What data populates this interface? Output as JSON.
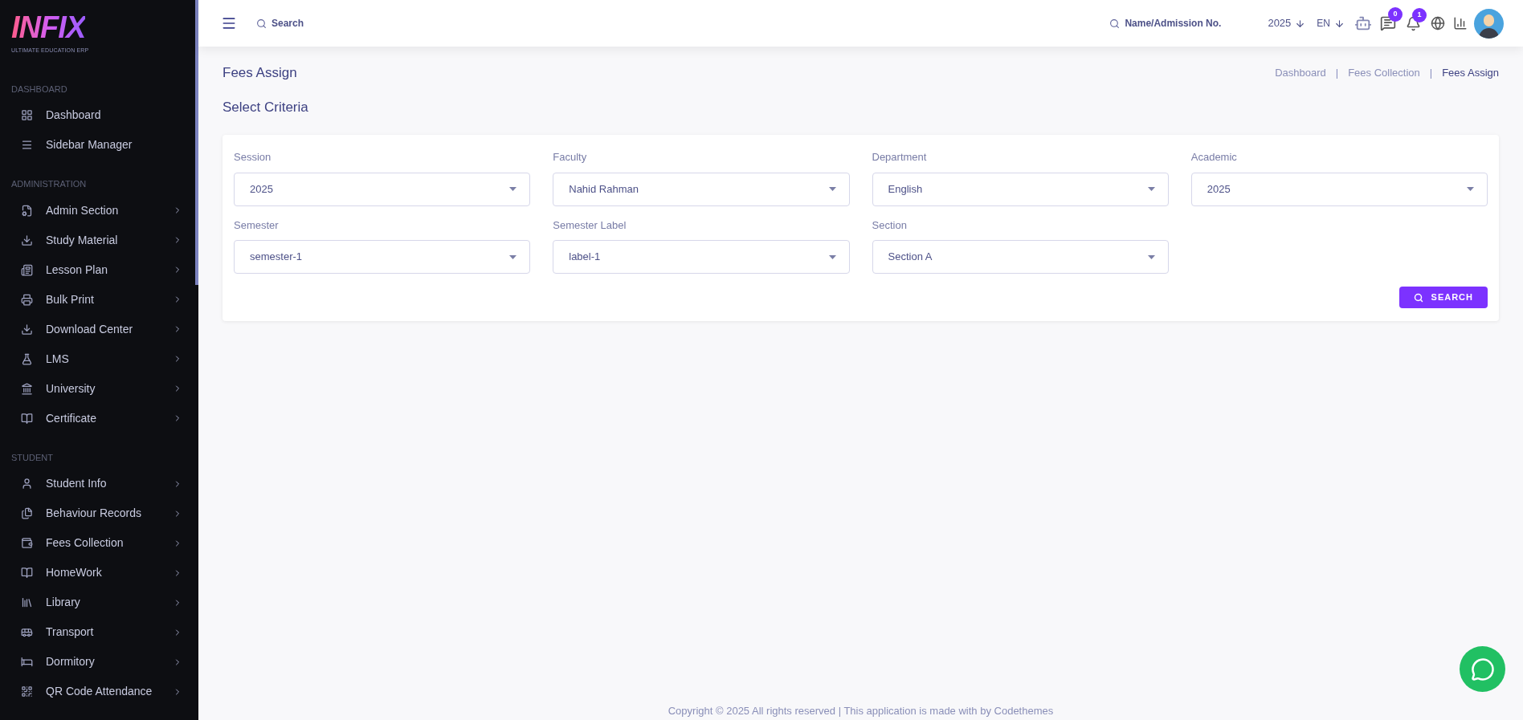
{
  "logo": {
    "text": "INFIX",
    "tagline": "ULTIMATE EDUCATION ERP"
  },
  "sidebar": {
    "sections": [
      {
        "heading": "DASHBOARD",
        "items": [
          {
            "label": "Dashboard",
            "expandable": false
          },
          {
            "label": "Sidebar Manager",
            "expandable": false
          }
        ]
      },
      {
        "heading": "ADMINISTRATION",
        "items": [
          {
            "label": "Admin Section",
            "expandable": true
          },
          {
            "label": "Study Material",
            "expandable": true
          },
          {
            "label": "Lesson Plan",
            "expandable": true
          },
          {
            "label": "Bulk Print",
            "expandable": true
          },
          {
            "label": "Download Center",
            "expandable": true
          },
          {
            "label": "LMS",
            "expandable": true
          },
          {
            "label": "University",
            "expandable": true
          },
          {
            "label": "Certificate",
            "expandable": true
          }
        ]
      },
      {
        "heading": "STUDENT",
        "items": [
          {
            "label": "Student Info",
            "expandable": true
          },
          {
            "label": "Behaviour Records",
            "expandable": true
          },
          {
            "label": "Fees Collection",
            "expandable": true
          },
          {
            "label": "HomeWork",
            "expandable": true
          },
          {
            "label": "Library",
            "expandable": true
          },
          {
            "label": "Transport",
            "expandable": true
          },
          {
            "label": "Dormitory",
            "expandable": true
          },
          {
            "label": "QR Code Attendance",
            "expandable": true
          }
        ]
      }
    ]
  },
  "header": {
    "search": {
      "placeholder": "Search"
    },
    "student_search": {
      "placeholder": "Name/Admission No."
    },
    "year": "2025",
    "language": "EN",
    "messages_count": "0",
    "notifications_count": "1"
  },
  "page": {
    "title": "Fees Assign",
    "breadcrumbs": [
      "Dashboard",
      "Fees Collection",
      "Fees Assign"
    ],
    "breadcrumb_separator": "|",
    "subtitle": "Select Criteria"
  },
  "criteria": {
    "fields": [
      {
        "label": "Session",
        "value": "2025"
      },
      {
        "label": "Faculty",
        "value": "Nahid Rahman"
      },
      {
        "label": "Department",
        "value": "English"
      },
      {
        "label": "Academic",
        "value": "2025"
      },
      {
        "label": "Semester",
        "value": "semester-1"
      },
      {
        "label": "Semester Label",
        "value": "label-1"
      },
      {
        "label": "Section",
        "value": "Section A"
      }
    ],
    "button": "SEARCH"
  },
  "footer": "Copyright © 2025 All rights reserved | This application is made with by Codethemes"
}
